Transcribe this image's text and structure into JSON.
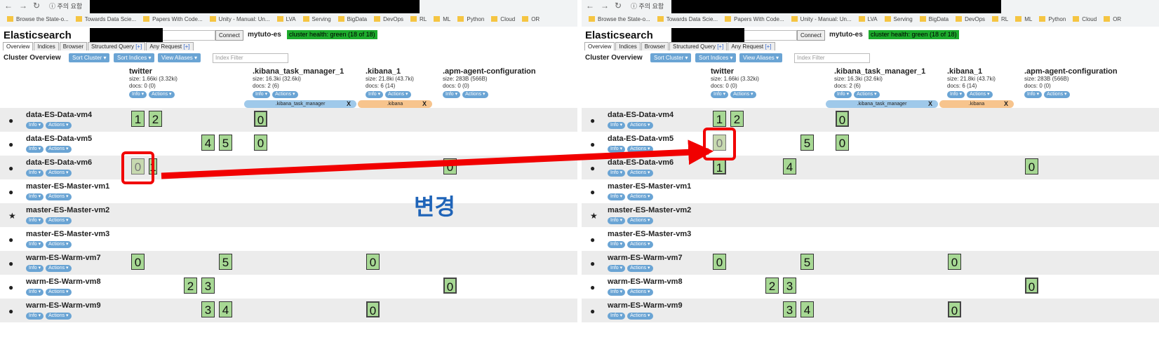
{
  "browser": {
    "security_label": "주의 요함",
    "bookmarks": [
      "Browse the State-o...",
      "Towards Data Scie...",
      "Papers With Code...",
      "Unity - Manual: Un...",
      "LVA",
      "Serving",
      "BigData",
      "DevOps",
      "RL",
      "ML",
      "Python",
      "Cloud",
      "OR"
    ]
  },
  "es": {
    "title": "Elasticsearch",
    "connect_label": "Connect",
    "cluster_name": "mytuto-es",
    "health": "cluster health: green (18 of 18)"
  },
  "tabs": {
    "overview": "Overview",
    "indices": "Indices",
    "browser": "Browser",
    "structured": "Structured Query",
    "any": "Any Request",
    "plus": "[+]"
  },
  "toolbar": {
    "title": "Cluster Overview",
    "sort_cluster": "Sort Cluster ▾",
    "sort_indices": "Sort Indices ▾",
    "view_aliases": "View Aliases ▾",
    "filter_placeholder": "Index Filter"
  },
  "pill_labels": {
    "info": "Info ▾",
    "actions": "Actions ▾"
  },
  "indices": [
    {
      "name": "twitter",
      "size": "size: 1.66ki (3.32ki)",
      "docs": "docs: 0 (0)"
    },
    {
      "name": ".kibana_task_manager_1",
      "size": "size: 16.3ki (32.6ki)",
      "docs": "docs: 2 (6)"
    },
    {
      "name": ".kibana_1",
      "size": "size: 21.8ki (43.7ki)",
      "docs": "docs: 6 (14)"
    },
    {
      "name": ".apm-agent-configuration",
      "size": "size: 283B (566B)",
      "docs": "docs: 0 (0)"
    }
  ],
  "aliases": [
    {
      "name": ".kibana_task_manager",
      "close": "X",
      "color": "#9fc9ea"
    },
    {
      "name": ".kibana",
      "close": "X",
      "color": "#f7c48d"
    }
  ],
  "nodes": [
    {
      "name": "data-ES-Data-vm4",
      "icon": "●"
    },
    {
      "name": "data-ES-Data-vm5",
      "icon": "●"
    },
    {
      "name": "data-ES-Data-vm6",
      "icon": "●"
    },
    {
      "name": "master-ES-Master-vm1",
      "icon": "●"
    },
    {
      "name": "master-ES-Master-vm2",
      "icon": "★"
    },
    {
      "name": "master-ES-Master-vm3",
      "icon": "●"
    },
    {
      "name": "warm-ES-Warm-vm7",
      "icon": "●"
    },
    {
      "name": "warm-ES-Warm-vm8",
      "icon": "●"
    },
    {
      "name": "warm-ES-Warm-vm9",
      "icon": "●"
    }
  ],
  "shards_before": [
    {
      "row": 0,
      "col": 0,
      "label": "1"
    },
    {
      "row": 0,
      "col": 1,
      "label": "2"
    },
    {
      "row": 0,
      "col": 5,
      "label": "0",
      "replica": true
    },
    {
      "row": 1,
      "col": 3,
      "label": "4"
    },
    {
      "row": 1,
      "col": 4,
      "label": "5"
    },
    {
      "row": 1,
      "col": 5,
      "label": "0"
    },
    {
      "row": 2,
      "col": 0,
      "label": "0",
      "relocating": true
    },
    {
      "row": 2,
      "col": 1,
      "label": "1",
      "partial": true
    },
    {
      "row": 2,
      "col": 8,
      "label": "0"
    },
    {
      "row": 6,
      "col": 0,
      "label": "0"
    },
    {
      "row": 6,
      "col": 4,
      "label": "5"
    },
    {
      "row": 6,
      "col": 7,
      "label": "0"
    },
    {
      "row": 7,
      "col": 2,
      "label": "2"
    },
    {
      "row": 7,
      "col": 3,
      "label": "3"
    },
    {
      "row": 7,
      "col": 8,
      "label": "0",
      "replica": true
    },
    {
      "row": 8,
      "col": 3,
      "label": "3"
    },
    {
      "row": 8,
      "col": 4,
      "label": "4"
    },
    {
      "row": 8,
      "col": 7,
      "label": "0",
      "replica": true
    }
  ],
  "shards_after": [
    {
      "row": 0,
      "col": 0,
      "label": "1"
    },
    {
      "row": 0,
      "col": 1,
      "label": "2"
    },
    {
      "row": 0,
      "col": 5,
      "label": "0",
      "replica": true
    },
    {
      "row": 1,
      "col": 0,
      "label": "0",
      "relocating": true
    },
    {
      "row": 1,
      "col": 4,
      "label": "5"
    },
    {
      "row": 1,
      "col": 5,
      "label": "0"
    },
    {
      "row": 2,
      "col": 0,
      "label": "1",
      "replica": true
    },
    {
      "row": 2,
      "col": 3,
      "label": "4"
    },
    {
      "row": 2,
      "col": 8,
      "label": "0"
    },
    {
      "row": 6,
      "col": 0,
      "label": "0"
    },
    {
      "row": 6,
      "col": 4,
      "label": "5"
    },
    {
      "row": 6,
      "col": 7,
      "label": "0"
    },
    {
      "row": 7,
      "col": 2,
      "label": "2"
    },
    {
      "row": 7,
      "col": 3,
      "label": "3"
    },
    {
      "row": 7,
      "col": 8,
      "label": "0",
      "replica": true
    },
    {
      "row": 8,
      "col": 3,
      "label": "3"
    },
    {
      "row": 8,
      "col": 4,
      "label": "4"
    },
    {
      "row": 8,
      "col": 7,
      "label": "0",
      "replica": true
    }
  ],
  "annotation": {
    "label": "변경",
    "color": "#f10000"
  }
}
